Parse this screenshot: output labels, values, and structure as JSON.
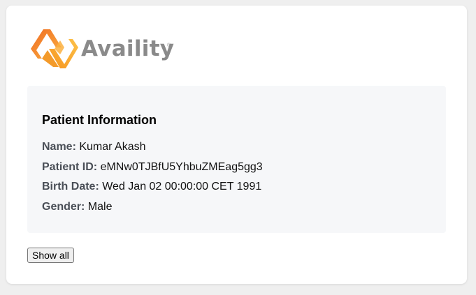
{
  "brand": {
    "name": "Availity",
    "registered_mark": "®",
    "logo_colors": [
      "#f7941d",
      "#fbb040",
      "#ef6c23"
    ],
    "text_color": "#8a8a8a"
  },
  "patient_info": {
    "title": "Patient Information",
    "name_label": "Name:",
    "name_value": "Kumar Akash",
    "id_label": "Patient ID:",
    "id_value": "eMNw0TJBfU5YhbuZMEag5gg3",
    "birth_label": "Birth Date:",
    "birth_value": "Wed Jan 02 00:00:00 CET 1991",
    "gender_label": "Gender:",
    "gender_value": "Male"
  },
  "actions": {
    "show_all_label": "Show all"
  }
}
